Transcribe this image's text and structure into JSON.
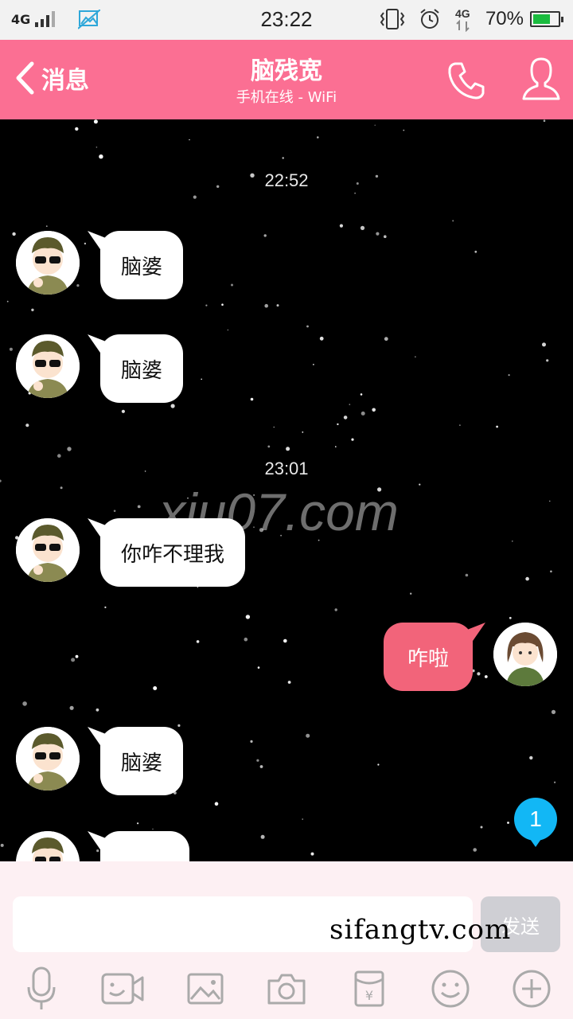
{
  "status_bar": {
    "network": "4G",
    "time": "23:22",
    "network_right": "4G",
    "battery_percent": "70%",
    "battery_level": 0.7,
    "icons": [
      "signal-icon",
      "image-icon",
      "vibrate-icon",
      "alarm-icon",
      "battery-icon"
    ]
  },
  "header": {
    "back_label": "消息",
    "title": "脑残宽",
    "subtitle": "手机在线 - WiFi",
    "color": "#fb6f93"
  },
  "messages": [
    {
      "type": "timestamp",
      "text": "22:52"
    },
    {
      "type": "in",
      "text": "脑婆"
    },
    {
      "type": "in",
      "text": "脑婆"
    },
    {
      "type": "timestamp",
      "text": "23:01"
    },
    {
      "type": "in",
      "text": "你咋不理我"
    },
    {
      "type": "out",
      "text": "咋啦"
    },
    {
      "type": "in",
      "text": "脑婆"
    },
    {
      "type": "in",
      "text": ""
    }
  ],
  "watermark_center": "xiu07.com",
  "unread_count": "1",
  "input": {
    "value": "",
    "send_label": "发送"
  },
  "watermark_bottom": "sifangtv.com",
  "toolbar": [
    "mic-icon",
    "video-icon",
    "image-icon",
    "camera-icon",
    "red-packet-icon",
    "emoji-icon",
    "plus-icon"
  ]
}
